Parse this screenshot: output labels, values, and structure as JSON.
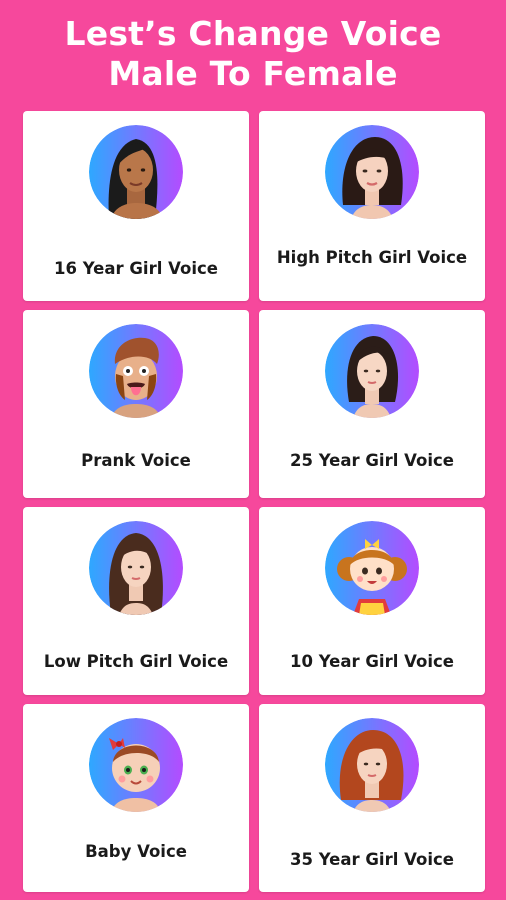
{
  "header": {
    "line1": "Lest’s Change Voice",
    "line2": "Male To Female"
  },
  "colors": {
    "background": "#f6489c",
    "card": "#ffffff",
    "avatar_gradient_start": "#2ea8ff",
    "avatar_gradient_end": "#b44cff"
  },
  "cards": [
    {
      "label": "16 Year Girl Voice",
      "icon": "teen-girl-avatar-icon"
    },
    {
      "label": "High Pitch Girl Voice",
      "icon": "woman-avatar-icon"
    },
    {
      "label": "Prank Voice",
      "icon": "prank-man-avatar-icon"
    },
    {
      "label": "25 Year Girl Voice",
      "icon": "young-woman-avatar-icon"
    },
    {
      "label": "Low Pitch Girl Voice",
      "icon": "long-hair-woman-avatar-icon"
    },
    {
      "label": "10 Year Girl Voice",
      "icon": "child-girl-avatar-icon"
    },
    {
      "label": "Baby Voice",
      "icon": "baby-avatar-icon"
    },
    {
      "label": "35 Year Girl Voice",
      "icon": "red-hair-woman-avatar-icon"
    }
  ]
}
